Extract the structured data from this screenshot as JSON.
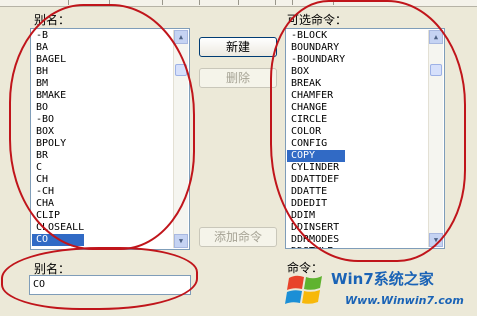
{
  "alias_panel": {
    "label": "别名：",
    "items": [
      "-B",
      "BA",
      "BAGEL",
      "BH",
      "BM",
      "BMAKE",
      "BO",
      "-BO",
      "BOX",
      "BPOLY",
      "BR",
      "C",
      "CH",
      "-CH",
      "CHA",
      "CLIP",
      "CLOSEALL",
      "CO"
    ],
    "selected": "CO"
  },
  "command_panel": {
    "label": "可选命令：",
    "items": [
      "-BLOCK",
      "BOUNDARY",
      "-BOUNDARY",
      "BOX",
      "BREAK",
      "CHAMFER",
      "CHANGE",
      "CIRCLE",
      "COLOR",
      "CONFIG",
      "COPY",
      "CYLINDER",
      "DDATTDEF",
      "DDATTE",
      "DDEDIT",
      "DDIM",
      "DDINSERT",
      "DDRMODES",
      "DDSTYLE"
    ],
    "selected": "COPY"
  },
  "buttons": {
    "new_label": "新建",
    "delete_label": "删除",
    "add_command_label": "添加命令"
  },
  "alias_field": {
    "label": "别名：",
    "value": "CO"
  },
  "command_field_label": "命令：",
  "watermark": {
    "brand": "Win7系统之家",
    "url": "Www.Winwin7.com"
  },
  "annotation_color": "#c0151b"
}
